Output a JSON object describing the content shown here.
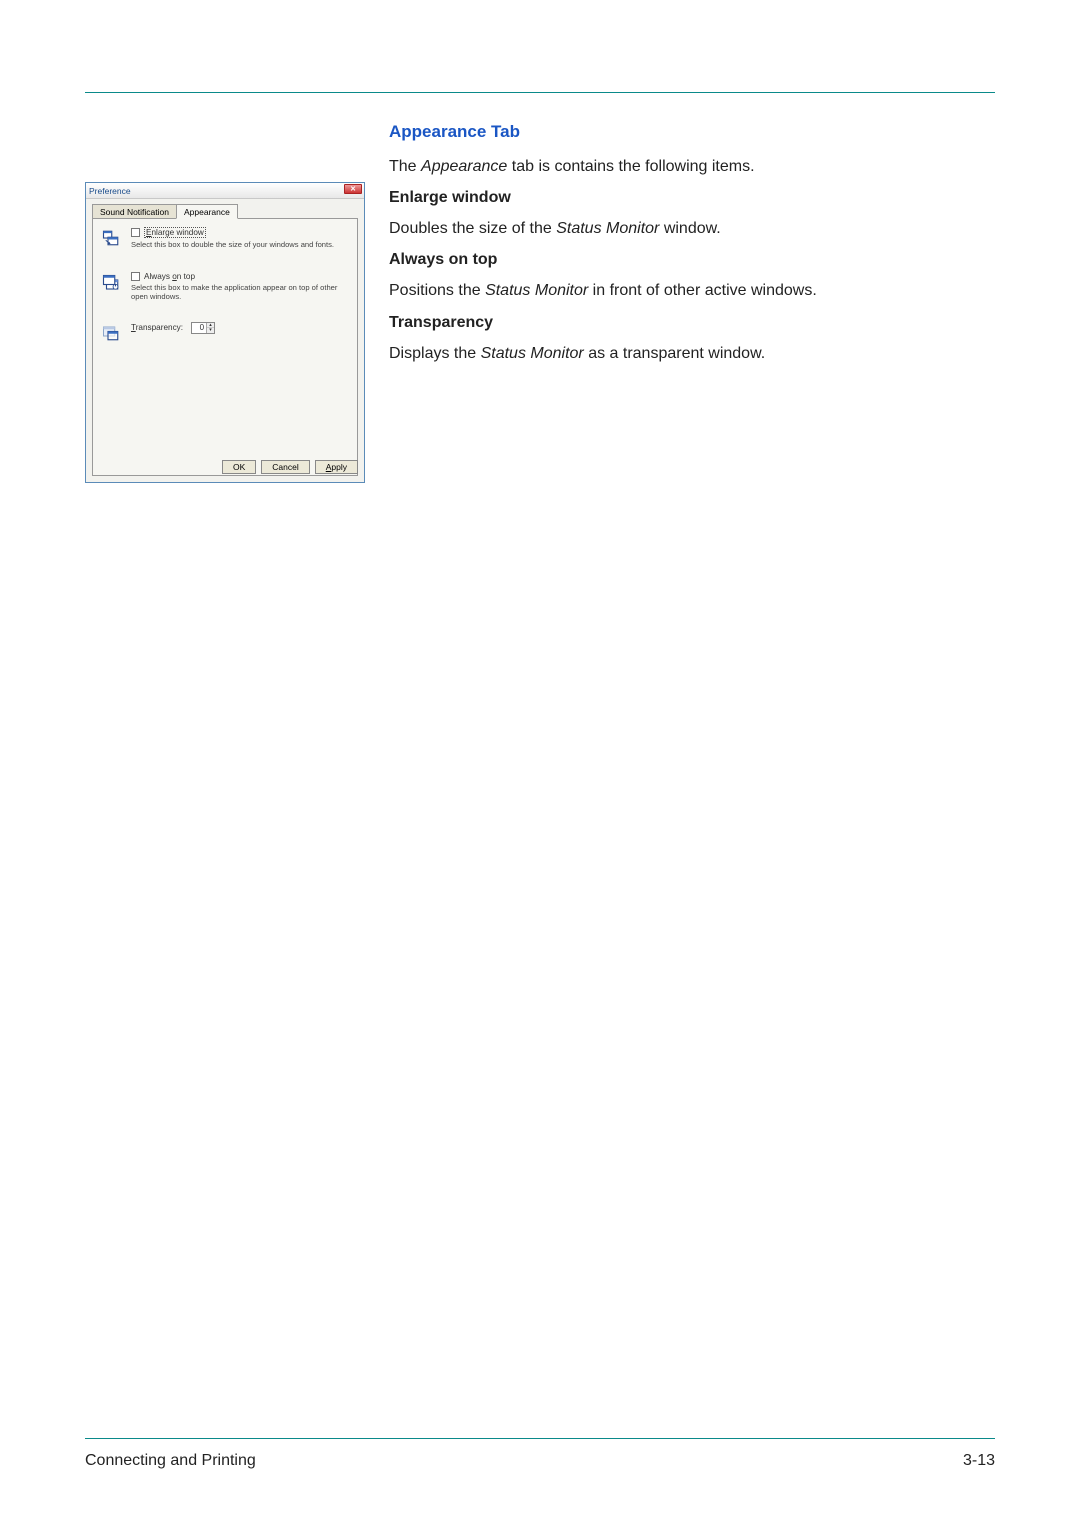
{
  "doc": {
    "heading": "Appearance Tab",
    "intro_prefix": "The ",
    "intro_em": "Appearance",
    "intro_suffix": " tab is contains the following items.",
    "items": [
      {
        "title": "Enlarge window",
        "desc_prefix": "Doubles the size of the ",
        "desc_em": "Status Monitor",
        "desc_suffix": " window."
      },
      {
        "title": "Always on top",
        "desc_prefix": "Positions the ",
        "desc_em": "Status Monitor",
        "desc_suffix": " in front of other active windows."
      },
      {
        "title": "Transparency",
        "desc_prefix": "Displays the ",
        "desc_em": "Status Monitor",
        "desc_suffix": " as a transparent window."
      }
    ]
  },
  "dialog": {
    "title": "Preference",
    "close_glyph": "✕",
    "tabs": {
      "inactive": "Sound Notification",
      "active": "Appearance"
    },
    "enlarge": {
      "label_u": "E",
      "label_rest": "nlarge window",
      "desc": "Select this box to double the size of your windows and fonts."
    },
    "ontop": {
      "label_pre": "Always ",
      "label_u": "o",
      "label_post": "n top",
      "desc": "Select this box to make the application appear on top of other open windows."
    },
    "transparency": {
      "label_u": "T",
      "label_rest": "ransparency:",
      "value": "0",
      "arrow_up": "▴",
      "arrow_dn": "▾"
    },
    "buttons": {
      "ok": "OK",
      "cancel": "Cancel",
      "apply_u": "A",
      "apply_rest": "pply"
    }
  },
  "footer": {
    "left": "Connecting and Printing",
    "right": "3-13"
  }
}
